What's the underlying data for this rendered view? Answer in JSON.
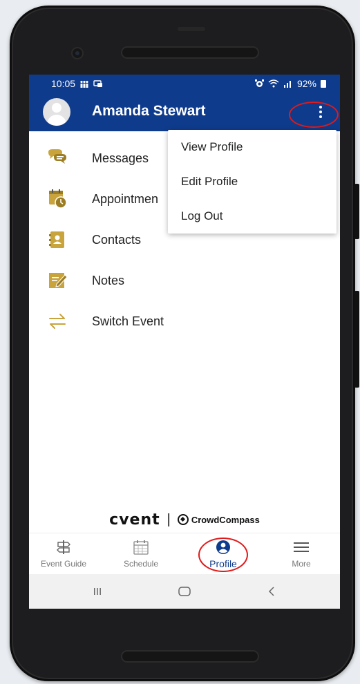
{
  "status_bar": {
    "time": "10:05",
    "battery": "92%",
    "icons": [
      "people-notification-icon",
      "message-notification-icon",
      "alarm-icon",
      "wifi-icon",
      "signal-icon",
      "battery-icon"
    ]
  },
  "header": {
    "user_name": "Amanda Stewart",
    "avatar": "default-avatar-icon",
    "overflow_icon": "more-vert-icon"
  },
  "menu": {
    "items": [
      {
        "label": "Messages",
        "icon": "chat-bubbles-icon"
      },
      {
        "label": "Appointmen",
        "icon": "calendar-clock-icon"
      },
      {
        "label": "Contacts",
        "icon": "contact-card-icon"
      },
      {
        "label": "Notes",
        "icon": "note-pencil-icon"
      },
      {
        "label": "Switch Event",
        "icon": "swap-arrows-icon"
      }
    ]
  },
  "dropdown": {
    "items": [
      {
        "label": "View Profile"
      },
      {
        "label": "Edit Profile"
      },
      {
        "label": "Log Out"
      }
    ]
  },
  "branding": {
    "primary": "cvent",
    "separator": "|",
    "secondary": "CrowdCompass"
  },
  "bottom_nav": {
    "tabs": [
      {
        "label": "Event Guide",
        "icon": "signpost-icon",
        "active": false
      },
      {
        "label": "Schedule",
        "icon": "calendar-icon",
        "active": false
      },
      {
        "label": "Profile",
        "icon": "profile-circle-icon",
        "active": true
      },
      {
        "label": "More",
        "icon": "menu-lines-icon",
        "active": false
      }
    ]
  },
  "colors": {
    "primary": "#0f3b8c",
    "icon_gold": "#c9a43d",
    "annotation": "#e01a1a",
    "page_bg": "#e9ecf0"
  }
}
